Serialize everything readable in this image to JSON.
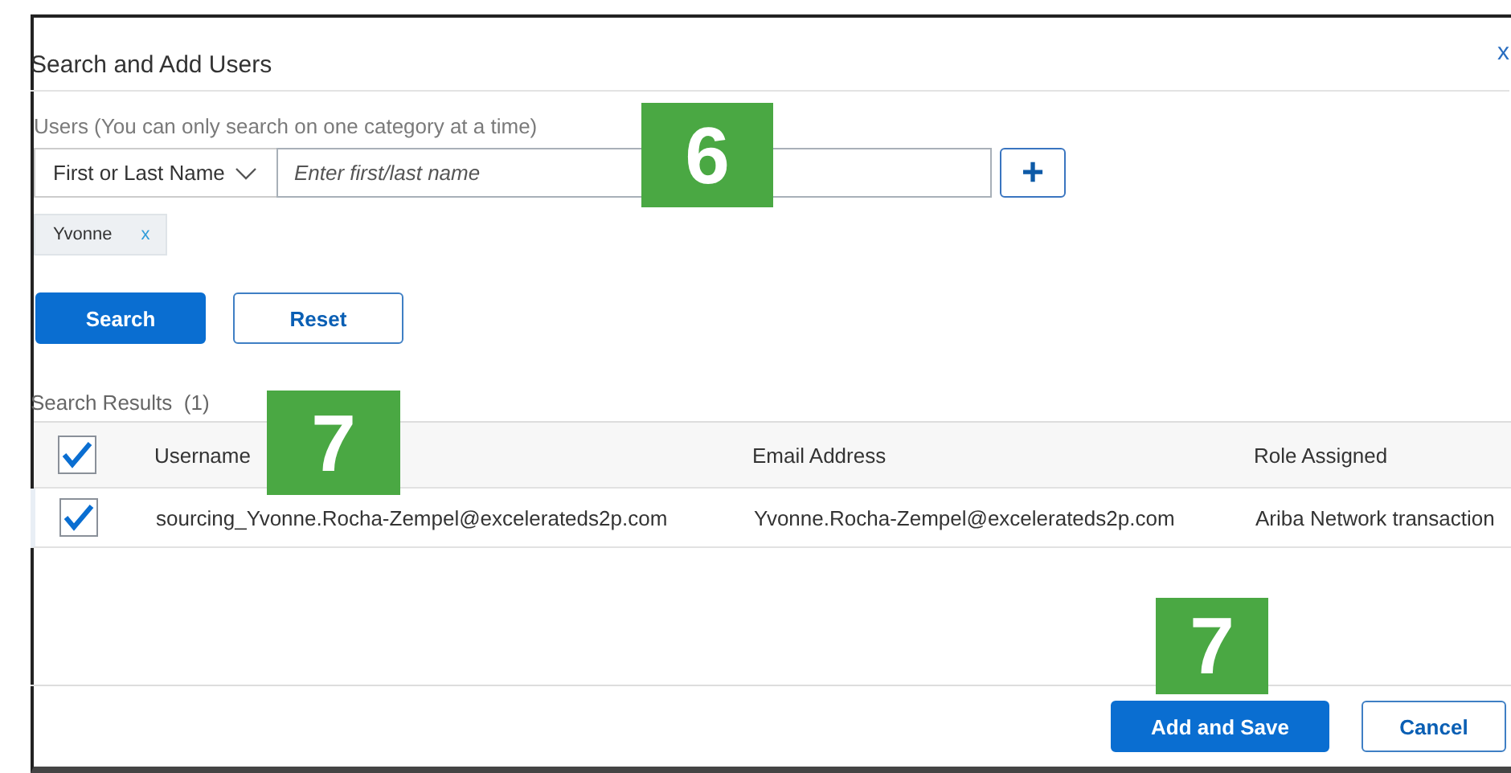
{
  "dialog": {
    "title": "Search and Add Users",
    "close": "x"
  },
  "search": {
    "label": "Users (You can only search on one category at a time)",
    "category": "First or Last Name",
    "placeholder": "Enter first/last name",
    "add": "+"
  },
  "chips": [
    {
      "label": "Yvonne",
      "remove": "x"
    }
  ],
  "buttons": [
    {
      "label": "Search",
      "kind": "primary"
    },
    {
      "label": "Reset",
      "kind": "secondary"
    }
  ],
  "results": {
    "title": "Search Results",
    "count": "(1)",
    "all_checked": true,
    "columns": [
      "Username",
      "Email Address",
      "Role Assigned"
    ],
    "rows": [
      {
        "checked": true,
        "cells": [
          "sourcing_Yvonne.Rocha-Zempel@excelerateds2p.com",
          "Yvonne.Rocha-Zempel@excelerateds2p.com",
          "Ariba Network transaction"
        ]
      }
    ]
  },
  "footer": [
    {
      "label": "Add and Save",
      "kind": "primary"
    },
    {
      "label": "Cancel",
      "kind": "secondary"
    }
  ],
  "callouts": [
    {
      "label": "6",
      "kind": "search"
    },
    {
      "label": "7",
      "kind": "table"
    },
    {
      "label": "7",
      "kind": "footer"
    }
  ]
}
